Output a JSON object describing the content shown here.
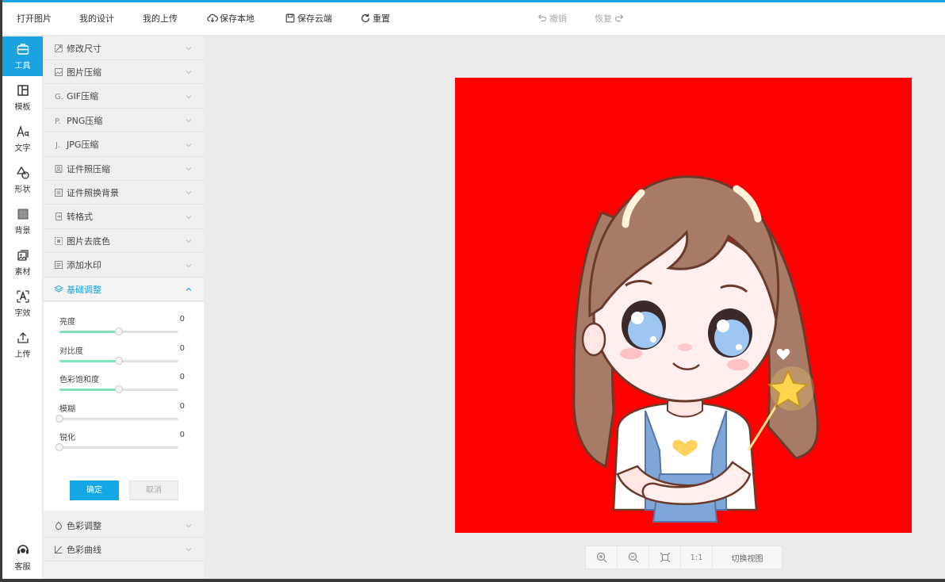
{
  "toolbar": {
    "open_image": "打开图片",
    "my_designs": "我的设计",
    "my_uploads": "我的上传",
    "save_local": "保存本地",
    "save_cloud": "保存云端",
    "reset": "重置",
    "undo": "撤销",
    "redo": "恢复"
  },
  "nav": [
    {
      "label": "工具",
      "icon": "toolbox-icon",
      "active": true
    },
    {
      "label": "模板",
      "icon": "template-icon"
    },
    {
      "label": "文字",
      "icon": "text-icon"
    },
    {
      "label": "形状",
      "icon": "shapes-icon"
    },
    {
      "label": "背景",
      "icon": "background-icon"
    },
    {
      "label": "素材",
      "icon": "material-icon"
    },
    {
      "label": "字效",
      "icon": "text-effect-icon"
    },
    {
      "label": "上传",
      "icon": "upload-icon"
    }
  ],
  "nav_service": {
    "label": "客服",
    "icon": "customer-service-icon"
  },
  "panel": {
    "items": [
      {
        "label": "修改尺寸",
        "icon": "resize-icon"
      },
      {
        "label": "图片压缩",
        "icon": "image-compress-icon"
      },
      {
        "label": "GIF压缩",
        "icon": "gif-icon"
      },
      {
        "label": "PNG压缩",
        "icon": "png-icon"
      },
      {
        "label": "JPG压缩",
        "icon": "jpg-icon"
      },
      {
        "label": "证件照压缩",
        "icon": "id-photo-icon"
      },
      {
        "label": "证件照换背景",
        "icon": "id-background-icon"
      },
      {
        "label": "转格式",
        "icon": "convert-icon"
      },
      {
        "label": "图片去底色",
        "icon": "remove-bg-icon"
      },
      {
        "label": "添加水印",
        "icon": "watermark-icon"
      }
    ],
    "open_item": {
      "label": "基础调整",
      "icon": "layers-icon"
    },
    "sliders": [
      {
        "label": "亮度",
        "value": "0",
        "position": 0.5
      },
      {
        "label": "对比度",
        "value": "0",
        "position": 0.5
      },
      {
        "label": "色彩饱和度",
        "value": "0",
        "position": 0.5
      },
      {
        "label": "模糊",
        "value": "0",
        "position": 0
      },
      {
        "label": "锐化",
        "value": "0",
        "position": 0
      }
    ],
    "ok_label": "确定",
    "cancel_label": "取消",
    "after_items": [
      {
        "label": "色彩调整",
        "icon": "color-adjust-icon"
      },
      {
        "label": "色彩曲线",
        "icon": "curve-icon"
      }
    ]
  },
  "canvas": {
    "background_color": "#ff0000"
  },
  "zoombar": {
    "one_to_one": "1:1",
    "switch_view": "切换视图"
  },
  "colors": {
    "accent": "#1aa2e0",
    "slider_fill": "#7ee3b5"
  }
}
